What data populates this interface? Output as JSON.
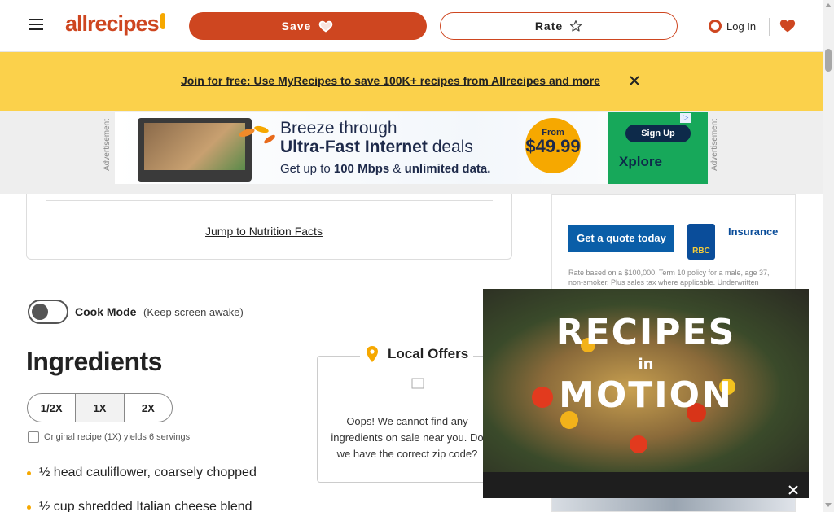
{
  "header": {
    "logo_text": "allrecipes",
    "save_label": "Save",
    "rate_label": "Rate",
    "login_label": "Log In"
  },
  "banner": {
    "link_text": "Join for free: Use MyRecipes to save 100K+ recipes from Allrecipes and more"
  },
  "ad_top": {
    "side_label": "Advertisement",
    "line1": "Breeze through",
    "line2_bold": "Ultra-Fast Internet",
    "line2_rest": " deals",
    "line3_pre": "Get up to ",
    "line3_bold1": "100 Mbps",
    "line3_mid": " & ",
    "line3_bold2": "unlimited data.",
    "price_from": "From",
    "price_amount": "$49.99",
    "signup_label": "Sign Up",
    "brand": "Xplore"
  },
  "content": {
    "jump_link": "Jump to Nutrition Facts",
    "cook_mode_label": "Cook Mode",
    "cook_mode_sub": "(Keep screen awake)",
    "ingredients_title": "Ingredients",
    "scale_options": [
      "1/2X",
      "1X",
      "2X"
    ],
    "yield_text": "Original recipe (1X) yields 6 servings",
    "ingredients": [
      "½ head cauliflower, coarsely chopped",
      "½ cup shredded Italian cheese blend"
    ]
  },
  "offers": {
    "title": "Local Offers",
    "message": "Oops! We cannot find any ingredients on sale near you. Do we have the correct zip code?"
  },
  "right_ad": {
    "quote_label": "Get a quote today",
    "brand_short": "RBC",
    "product": "Insurance",
    "fine_print": "Rate based on a $100,000, Term 10 policy for a male, age 37, non-smoker. Plus sales tax where applicable. Underwritten"
  },
  "video": {
    "line1": "RECIPES",
    "line2": "in",
    "line3": "MOTION"
  },
  "colors": {
    "brand": "#ce4620",
    "banner": "#fbd14b",
    "accent": "#f6a800"
  }
}
